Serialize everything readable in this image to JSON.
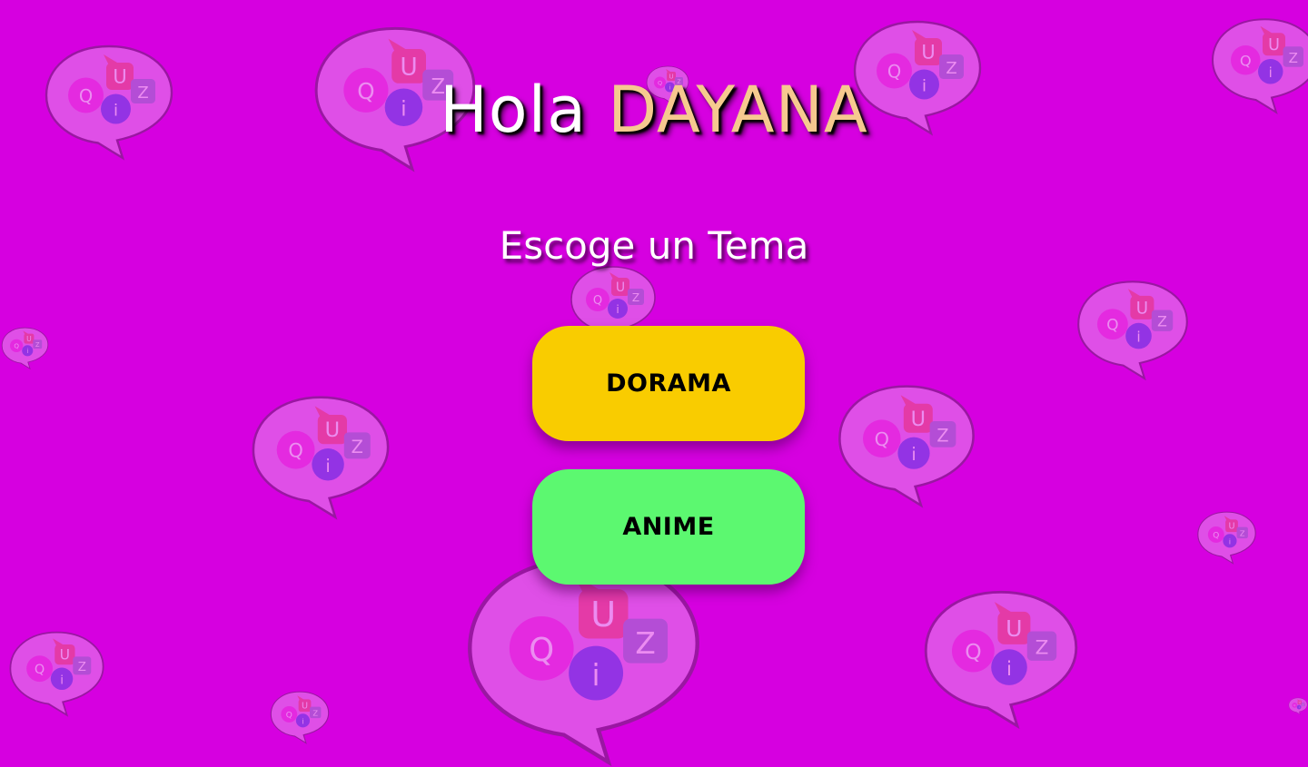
{
  "greeting": {
    "hello": "Hola",
    "username": "DAYANA"
  },
  "subtitle": "Escoge un Tema",
  "topics": [
    {
      "label": "DORAMA",
      "color": "#f9cc00"
    },
    {
      "label": "ANIME",
      "color": "#5cf870"
    }
  ],
  "colors": {
    "background": "#d600e0",
    "greeting_text": "#ffffff",
    "username_text": "#f6c98f"
  },
  "background_pattern": {
    "icon": "quiz-speech-bubble-icon",
    "letters": [
      "Q",
      "U",
      "i",
      "Z"
    ]
  }
}
